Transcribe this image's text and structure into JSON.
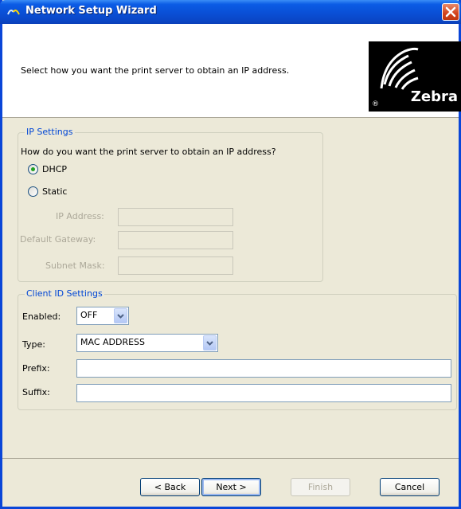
{
  "window": {
    "title": "Network Setup Wizard"
  },
  "header": {
    "instruction": "Select how you want the print server to obtain an IP address.",
    "logo_text": "Zebra",
    "logo_reg": "®"
  },
  "ip_settings": {
    "legend": "IP Settings",
    "question": "How do you want the print server to obtain an IP address?",
    "options": [
      {
        "label": "DHCP",
        "selected": true
      },
      {
        "label": "Static",
        "selected": false
      }
    ],
    "ip_address_label": "IP Address:",
    "gateway_label": "Default Gateway:",
    "subnet_label": "Subnet Mask:"
  },
  "client_id": {
    "legend": "Client ID Settings",
    "enabled_label": "Enabled:",
    "enabled_value": "OFF",
    "type_label": "Type:",
    "type_value": "MAC ADDRESS",
    "prefix_label": "Prefix:",
    "suffix_label": "Suffix:"
  },
  "buttons": {
    "back": "< Back",
    "next": "Next >",
    "finish": "Finish",
    "cancel": "Cancel"
  },
  "colors": {
    "titlebar": "#0a4fd6",
    "legend": "#0046d5",
    "dialog_bg": "#ece9d8"
  }
}
